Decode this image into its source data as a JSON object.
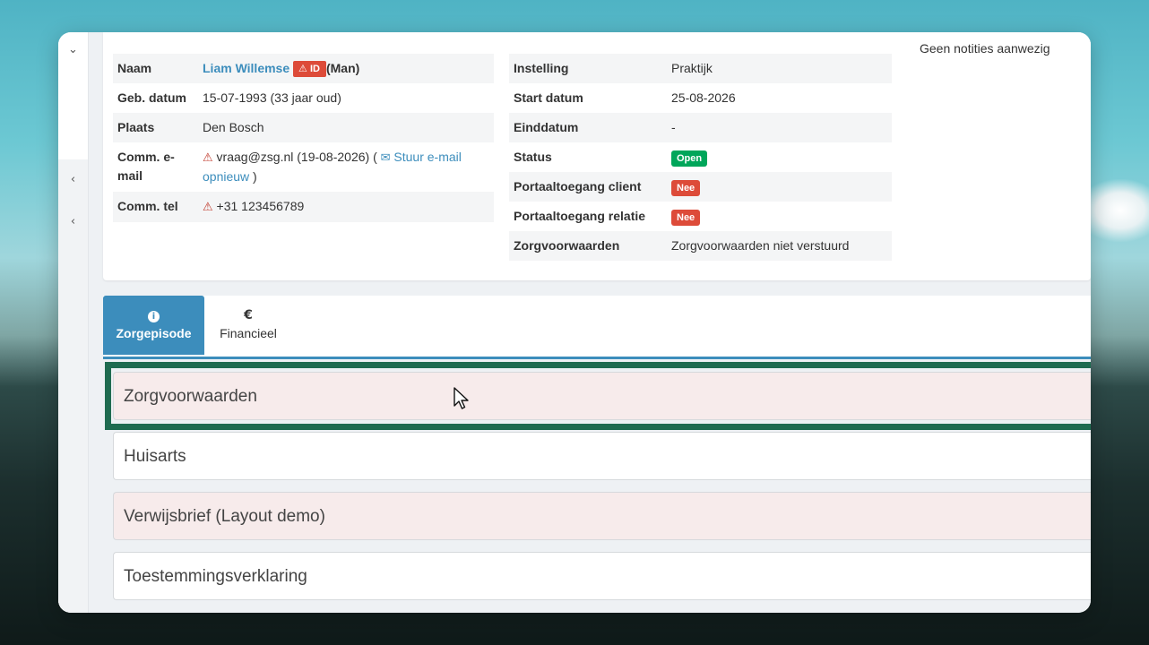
{
  "patient": {
    "rows": [
      {
        "label": "Naam",
        "name": "Liam Willemse",
        "id_badge": "ID",
        "gender": "(Man)"
      },
      {
        "label": "Geb. datum",
        "value": "15-07-1993 (33 jaar oud)"
      },
      {
        "label": "Plaats",
        "value": "Den Bosch"
      },
      {
        "label": "Comm. e-mail",
        "email": "vraag@zsg.nl (19-08-2026) (",
        "resend_link": "Stuur e-mail opnieuw",
        "close_paren": ")"
      },
      {
        "label": "Comm. tel",
        "phone": "+31 123456789"
      }
    ]
  },
  "episode": {
    "rows": [
      {
        "label": "Instelling",
        "value": "Praktijk"
      },
      {
        "label": "Start datum",
        "value": "25-08-2026"
      },
      {
        "label": "Einddatum",
        "value": "-"
      },
      {
        "label": "Status",
        "badge": "Open"
      },
      {
        "label": "Portaaltoegang client",
        "badge": "Nee"
      },
      {
        "label": "Portaaltoegang relatie",
        "badge": "Nee"
      },
      {
        "label": "Zorgvoorwaarden",
        "value": "Zorgvoorwaarden niet verstuurd"
      }
    ]
  },
  "notes": {
    "text": "Geen notities aanwezig"
  },
  "tabs": [
    {
      "label": "Zorgepisode",
      "icon": "info-icon",
      "active": true
    },
    {
      "label": "Financieel",
      "icon": "euro-icon",
      "glyph": "€",
      "active": false
    }
  ],
  "panels": [
    {
      "title": "Zorgvoorwaarden"
    },
    {
      "title": "Huisarts"
    },
    {
      "title": "Verwijsbrief (Layout demo)"
    },
    {
      "title": "Toestemmingsverklaring"
    }
  ],
  "colors": {
    "accent": "#3c8dbc",
    "danger": "#dd4b39",
    "success": "#00a65a",
    "selection": "#1f6b50",
    "panel_pink": "#f7ebeb"
  }
}
